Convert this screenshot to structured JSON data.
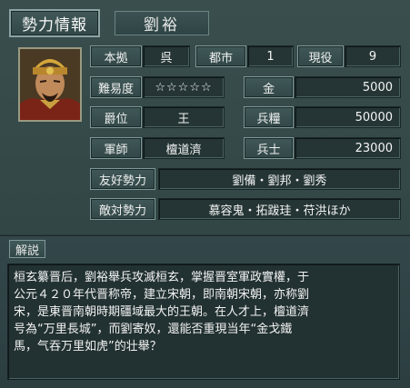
{
  "header": {
    "title": "勢力情報",
    "ruler_name": "劉裕"
  },
  "stats": {
    "honkyo_label": "本拠",
    "honkyo_value": "呉",
    "toshi_label": "都市",
    "toshi_value": "1",
    "geneki_label": "現役",
    "geneki_value": "9",
    "difficulty_label": "難易度",
    "difficulty_value": "☆☆☆☆☆",
    "gold_label": "金",
    "gold_value": "5000",
    "rank_label": "爵位",
    "rank_value": "王",
    "food_label": "兵糧",
    "food_value": "50000",
    "advisor_label": "軍師",
    "advisor_value": "檀道濟",
    "soldiers_label": "兵士",
    "soldiers_value": "23000"
  },
  "relations": {
    "friendly_label": "友好勢力",
    "friendly_value": "劉備・劉邦・劉秀",
    "hostile_label": "敵対勢力",
    "hostile_value": "慕容鬼・拓跋珪・苻洪ほか"
  },
  "explanation": {
    "tab_label": "解説",
    "lines": [
      "桓玄纂晋后，劉裕舉兵攻滅桓玄，掌握晋室軍政實權，于",
      "公元４２０年代晋称帝，建立宋朝，即南朝宋朝，亦称劉",
      "宋，是東晋南朝時期疆域最大的王朝。在人才上，檀道濟",
      "号為“万里長城”，而劉寄奴，還能否重現当年“金戈鐵",
      "馬，气吞万里如虎”的壮舉？"
    ]
  },
  "icons": {
    "portrait": "ruler-portrait-liu-yu"
  }
}
